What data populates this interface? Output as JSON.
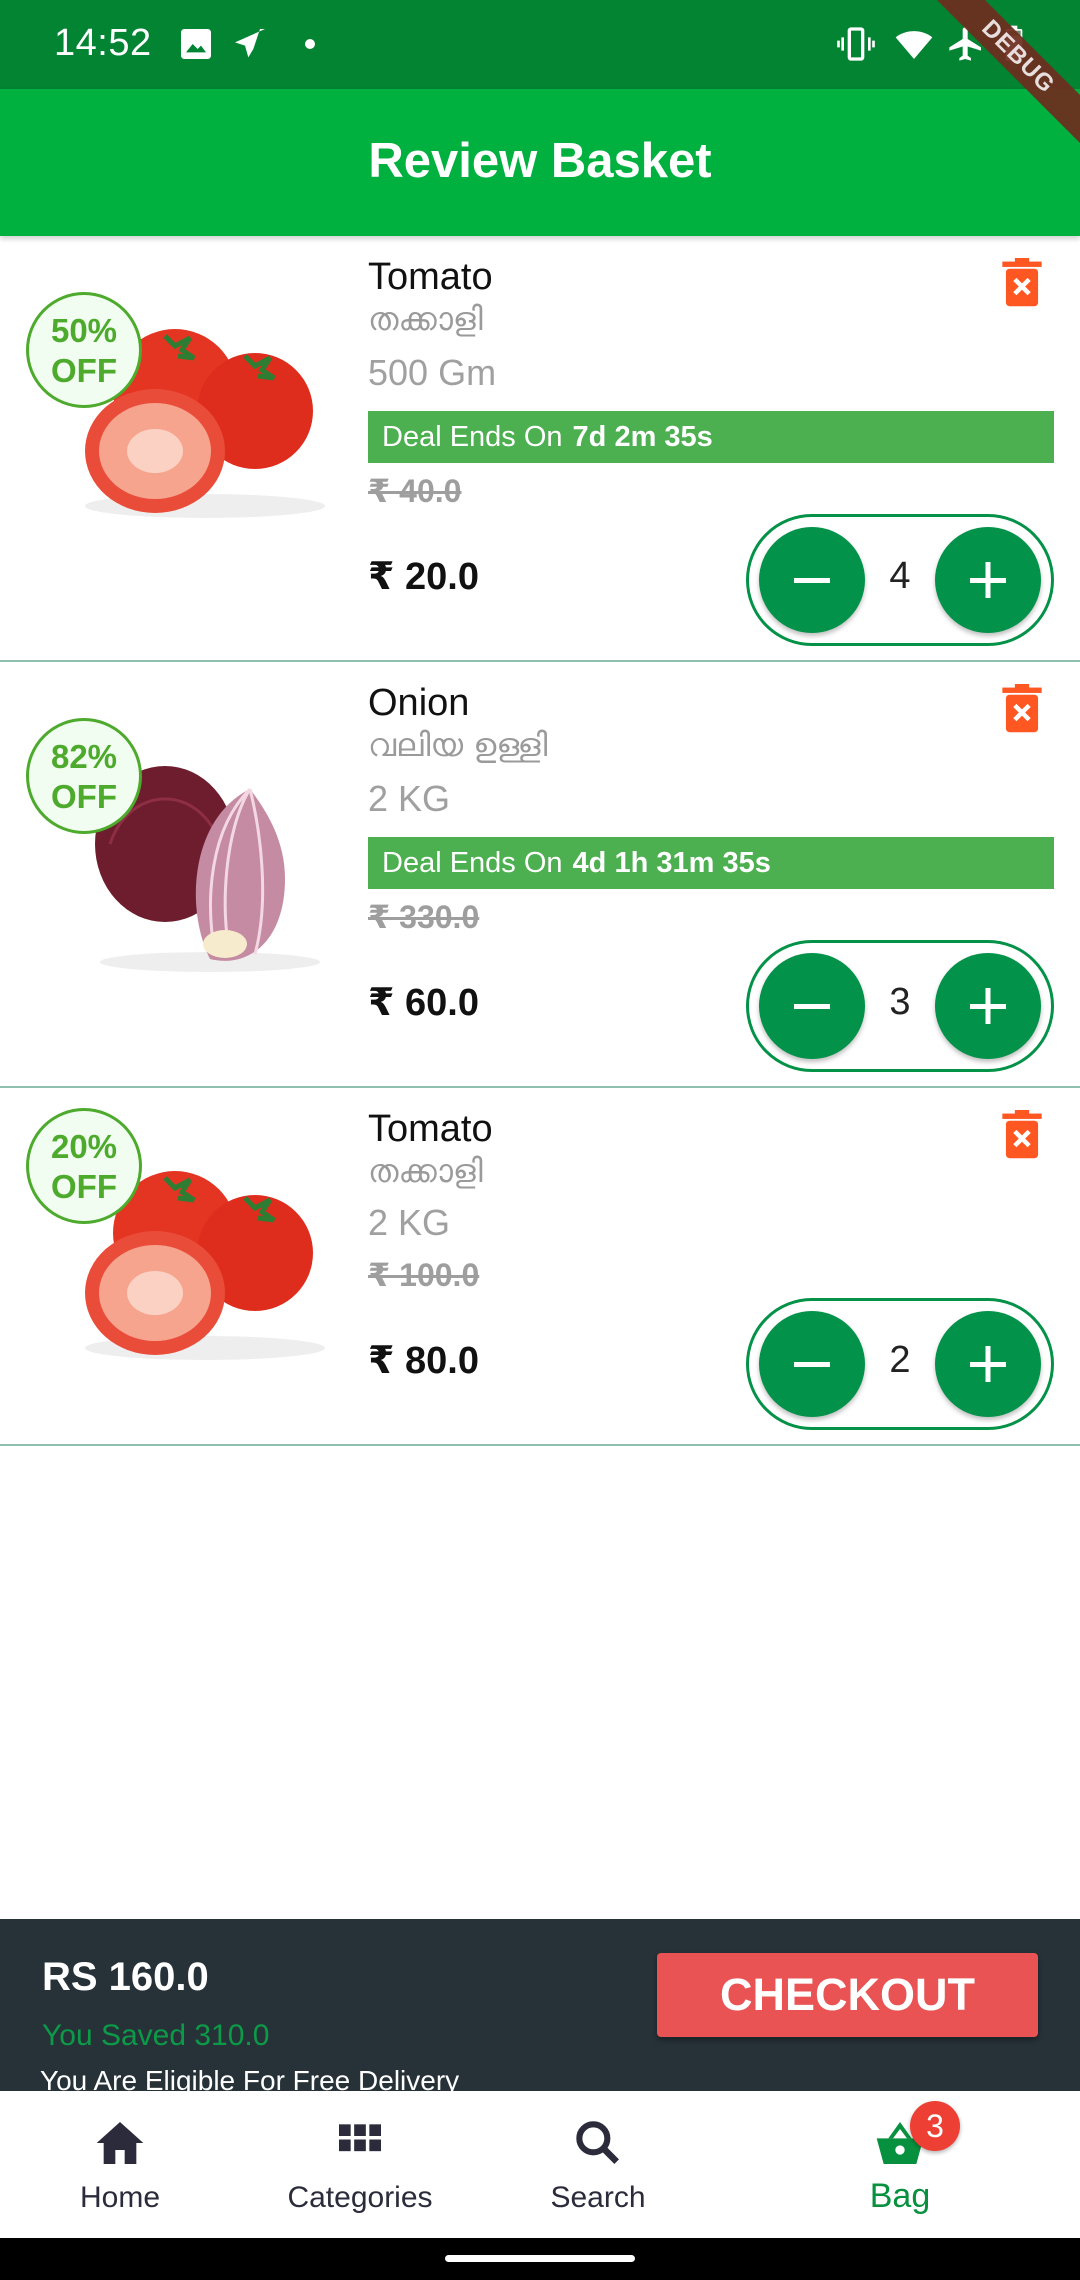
{
  "status_bar": {
    "time": "14:52",
    "left_icons": [
      "image-icon",
      "telegram-icon",
      "dot-icon"
    ],
    "right_icons": [
      "vibrate-icon",
      "wifi-icon",
      "airplane-icon",
      "battery-icon"
    ],
    "debug_label": "DEBUG"
  },
  "app_bar": {
    "title": "Review Basket"
  },
  "cart": {
    "items": [
      {
        "discount": "50%",
        "discount_suffix": "OFF",
        "name": "Tomato",
        "local_name": "തക്കാളി",
        "unit": "500 Gm",
        "deal_prefix": "Deal Ends On",
        "deal_time": "7d 2m 35s",
        "old_price": "₹ 40.0",
        "price": "₹ 20.0",
        "quantity": "4",
        "image": "tomato"
      },
      {
        "discount": "82%",
        "discount_suffix": "OFF",
        "name": "Onion",
        "local_name": "വലിയ ഉള്ളി",
        "unit": "2 KG",
        "deal_prefix": "Deal Ends On",
        "deal_time": "4d 1h 31m 35s",
        "old_price": "₹ 330.0",
        "price": "₹ 60.0",
        "quantity": "3",
        "image": "onion"
      },
      {
        "discount": "20%",
        "discount_suffix": "OFF",
        "name": "Tomato",
        "local_name": "തക്കാളി",
        "unit": "2 KG",
        "old_price": "₹ 100.0",
        "price": "₹ 80.0",
        "quantity": "2",
        "image": "tomato"
      }
    ]
  },
  "summary": {
    "total": "RS 160.0",
    "saved": "You Saved 310.0",
    "delivery_note": "You Are Eligible For Free Delivery",
    "checkout_label": "CHECKOUT"
  },
  "bottom_nav": {
    "items": [
      {
        "label": "Home",
        "icon": "home-icon"
      },
      {
        "label": "Categories",
        "icon": "grid-icon"
      },
      {
        "label": "Search",
        "icon": "search-icon"
      },
      {
        "label": "Bag",
        "icon": "basket-icon",
        "badge": "3",
        "active": true
      }
    ]
  },
  "colors": {
    "status_bar": "#028433",
    "app_bar": "#00b140",
    "accent_green": "#03924a",
    "deal_bar": "#4caf50",
    "discount_green": "#4daa2c",
    "delete_orange": "#ff5722",
    "summary_bg": "#263238",
    "checkout_red": "#ea5353",
    "badge_red": "#ee3f35"
  }
}
